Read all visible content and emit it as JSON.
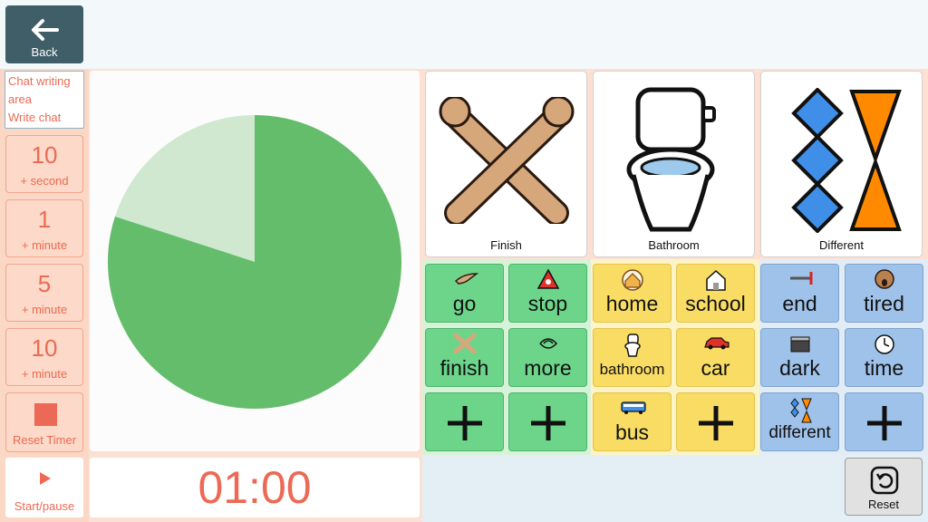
{
  "header": {
    "back_label": "Back"
  },
  "chat": {
    "line1": "Chat writing",
    "line2": "area",
    "line3": "Write chat"
  },
  "timer_buttons": [
    {
      "num": "10",
      "sub": "+ second"
    },
    {
      "num": "1",
      "sub": "+ minute"
    },
    {
      "num": "5",
      "sub": "+ minute"
    },
    {
      "num": "10",
      "sub": "+ minute"
    }
  ],
  "reset_timer_label": "Reset Timer",
  "start_label": "Start/pause",
  "timer": {
    "display": "01:00",
    "remaining_fraction": 0.8
  },
  "big_cells": [
    {
      "label": "Finish",
      "icon": "crossed-arms-icon"
    },
    {
      "label": "Bathroom",
      "icon": "toilet-icon"
    },
    {
      "label": "Different",
      "icon": "different-shapes-icon"
    }
  ],
  "word_cells": [
    {
      "label": "go",
      "color": "green",
      "icon": "pointing-hand-icon"
    },
    {
      "label": "stop",
      "color": "green",
      "icon": "stop-sign-icon"
    },
    {
      "label": "home",
      "color": "yellow",
      "icon": "house-icon"
    },
    {
      "label": "school",
      "color": "yellow",
      "icon": "school-icon"
    },
    {
      "label": "end",
      "color": "blue",
      "icon": "end-line-icon"
    },
    {
      "label": "tired",
      "color": "blue",
      "icon": "yawn-face-icon"
    },
    {
      "label": "finish",
      "color": "green",
      "icon": "crossed-arms-icon"
    },
    {
      "label": "more",
      "color": "green",
      "icon": "more-hands-icon"
    },
    {
      "label": "bathroom",
      "color": "yellow",
      "icon": "toilet-icon"
    },
    {
      "label": "car",
      "color": "yellow",
      "icon": "car-icon"
    },
    {
      "label": "dark",
      "color": "blue",
      "icon": "dark-shade-icon"
    },
    {
      "label": "time",
      "color": "blue",
      "icon": "clock-icon"
    },
    {
      "label": "",
      "color": "green",
      "icon": "plus-icon"
    },
    {
      "label": "",
      "color": "green",
      "icon": "plus-icon"
    },
    {
      "label": "bus",
      "color": "yellow",
      "icon": "bus-icon"
    },
    {
      "label": "",
      "color": "yellow",
      "icon": "plus-icon"
    },
    {
      "label": "different",
      "color": "blue",
      "icon": "different-shapes-icon"
    },
    {
      "label": "",
      "color": "blue",
      "icon": "plus-icon"
    }
  ],
  "reset_label": "Reset",
  "colors": {
    "accent": "#ec6a55",
    "pie_filled": "#63bd6b",
    "pie_empty": "#cfe8cf",
    "green": "#6dd58a",
    "yellow": "#f9dc64",
    "blue": "#9fc2ea"
  }
}
